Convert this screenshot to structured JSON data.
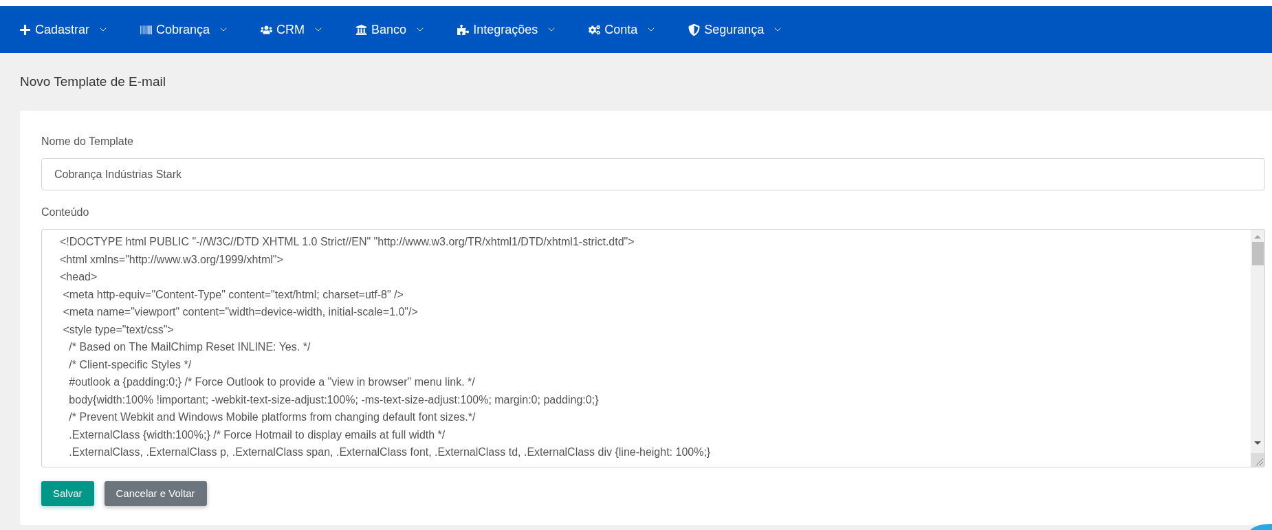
{
  "nav": [
    {
      "kind": "plus",
      "label": "Cadastrar"
    },
    {
      "kind": "barcode",
      "label": "Cobrança"
    },
    {
      "kind": "users",
      "label": "CRM"
    },
    {
      "kind": "bank",
      "label": "Banco"
    },
    {
      "kind": "puzzle",
      "label": "Integrações"
    },
    {
      "kind": "cogs",
      "label": "Conta"
    },
    {
      "kind": "shield",
      "label": "Segurança"
    }
  ],
  "page_title": "Novo Template de E-mail",
  "form": {
    "name_label": "Nome do Template",
    "name_value": "Cobrança Indústrias Stark",
    "content_label": "Conteúdo",
    "content_lines": [
      "<!DOCTYPE html PUBLIC \"-//W3C//DTD XHTML 1.0 Strict//EN\" \"http://www.w3.org/TR/xhtml1/DTD/xhtml1-strict.dtd\">",
      "<html xmlns=\"http://www.w3.org/1999/xhtml\">",
      "<head>",
      " <meta http-equiv=\"Content-Type\" content=\"text/html; charset=utf-8\" />",
      " <meta name=\"viewport\" content=\"width=device-width, initial-scale=1.0\"/>",
      " <style type=\"text/css\">",
      "   /* Based on The MailChimp Reset INLINE: Yes. */",
      "   /* Client-specific Styles */",
      "   #outlook a {padding:0;} /* Force Outlook to provide a \"view in browser\" menu link. */",
      "   body{width:100% !important; -webkit-text-size-adjust:100%; -ms-text-size-adjust:100%; margin:0; padding:0;}",
      "   /* Prevent Webkit and Windows Mobile platforms from changing default font sizes.*/",
      "   .ExternalClass {width:100%;} /* Force Hotmail to display emails at full width */",
      "   .ExternalClass, .ExternalClass p, .ExternalClass span, .ExternalClass font, .ExternalClass td, .ExternalClass div {line-height: 100%;}"
    ]
  },
  "buttons": [
    {
      "kind": "primary",
      "label": "Salvar"
    },
    {
      "kind": "secondary",
      "label": "Cancelar e Voltar"
    }
  ]
}
